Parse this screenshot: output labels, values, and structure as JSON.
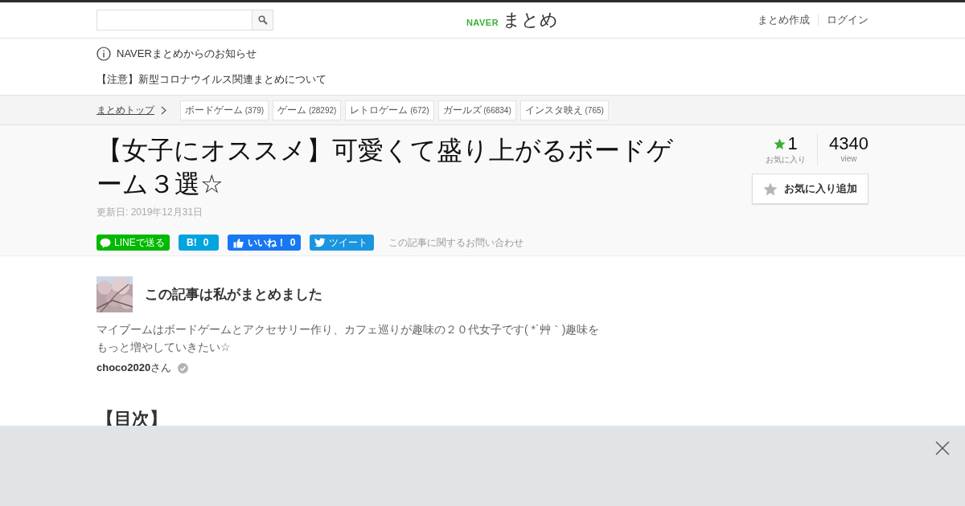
{
  "header": {
    "search": {
      "kind": "input"
    },
    "logo": {
      "brand": "NAVER",
      "name": "まとめ"
    },
    "links": [
      "まとめ作成",
      "ログイン"
    ]
  },
  "notice": {
    "title": "NAVERまとめからのお知らせ",
    "items": [
      "【注意】新型コロナウイルス関連まとめについて"
    ]
  },
  "breadcrumb": {
    "home": "まとめトップ",
    "tags": [
      {
        "label": "ボードゲーム",
        "count": "(379)"
      },
      {
        "label": "ゲーム",
        "count": "(28292)"
      },
      {
        "label": "レトロゲーム",
        "count": "(672)"
      },
      {
        "label": "ガールズ",
        "count": "(66834)"
      },
      {
        "label": "インスタ映え",
        "count": "(765)"
      }
    ]
  },
  "article": {
    "title": "【女子にオススメ】可愛くて盛り上がるボードゲーム３選☆",
    "updated": "更新日: 2019年12月31日",
    "share": [
      {
        "kind": "line",
        "label": "LINEで送る"
      },
      {
        "kind": "hatena",
        "label": "B!",
        "count": "0"
      },
      {
        "kind": "facebook",
        "label": "いいね！",
        "count": "0"
      },
      {
        "kind": "twitter",
        "label": "ツイート"
      }
    ],
    "contact": "この記事に関するお問い合わせ",
    "favorites": {
      "count": "1",
      "label": "お気に入り"
    },
    "views": {
      "count": "4340",
      "label": "view"
    },
    "favorite_button": "お気に入り追加"
  },
  "author": {
    "heading": "この記事は私がまとめました",
    "bio": "マイブームはボードゲームとアクセサリー作り、カフェ巡りが趣味の２０代女子です( *´艸｀)趣味をもっと増やしていきたい☆",
    "name": "choco2020",
    "suffix": "さん",
    "verified": true
  },
  "toc_heading": "【目次】",
  "ad_overlay": {
    "kind": "empty"
  }
}
